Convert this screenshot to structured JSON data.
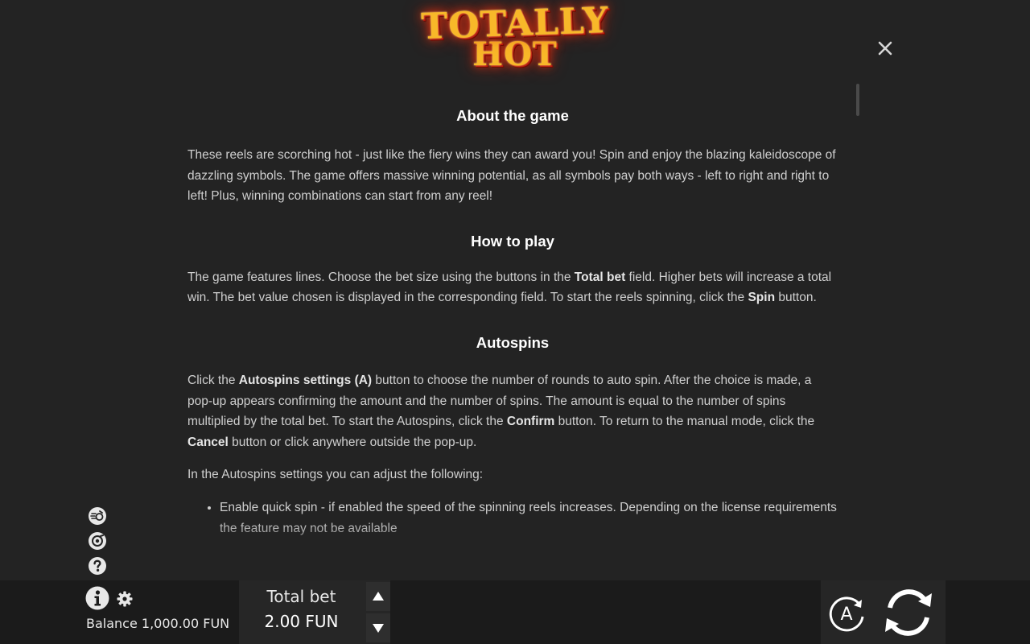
{
  "logo": {
    "line1": "TOTALLY",
    "line2": "HOT"
  },
  "about": {
    "heading": "About the game",
    "text": "These reels are scorching hot - just like the fiery wins they can award you! Spin and enjoy the blazing kaleidoscope of dazzling symbols. The game offers massive winning potential, as all symbols pay both ways - left to right and right to left! Plus, winning combinations can start from any reel!"
  },
  "how_to_play": {
    "heading": "How to play",
    "text_1": "The game features lines. Choose the bet size using the buttons in the ",
    "bold_1": "Total bet",
    "text_2": " field. Higher bets will increase a total win. The bet value chosen is displayed in the corresponding field. To start the reels spinning, click the ",
    "bold_2": "Spin",
    "text_3": " button."
  },
  "autospins": {
    "heading": "Autospins",
    "text_1": "Click the ",
    "bold_1": "Autospins settings (A)",
    "text_2": " button to choose the number of rounds to auto spin. After the choice is made, a pop-up appears confirming the amount and the number of spins. The amount is equal to the number of spins multiplied by the total bet. To start the Autospins, click the ",
    "bold_2": "Confirm",
    "text_3": " button. To return to the manual mode, click the ",
    "bold_3": "Cancel",
    "text_4": " button or click anywhere outside the pop-up.",
    "settings_intro": "In the Autospins settings you can adjust the following:",
    "options": [
      "Enable quick spin - if enabled the speed of the spinning reels increases. Depending on the license requirements the feature may not be available"
    ]
  },
  "bottom_bar": {
    "balance_label": "Balance",
    "balance_value": "1,000.00 FUN",
    "total_bet_label": "Total bet",
    "total_bet_value": "2.00 FUN",
    "autospin_label": "A"
  },
  "icons": {
    "close": "close-icon",
    "quick_spin": "quick-spin-icon",
    "sound": "sound-icon",
    "help": "help-icon",
    "info": "info-icon",
    "settings": "gear-icon",
    "bet_up": "triangle-up-icon",
    "bet_down": "triangle-down-icon",
    "autospin": "autospin-icon",
    "spin": "spin-icon"
  },
  "colors": {
    "background": "#232323",
    "bar": "#1b1b1b",
    "logo_gold": "#f8b829",
    "logo_red": "#d81c0a"
  }
}
